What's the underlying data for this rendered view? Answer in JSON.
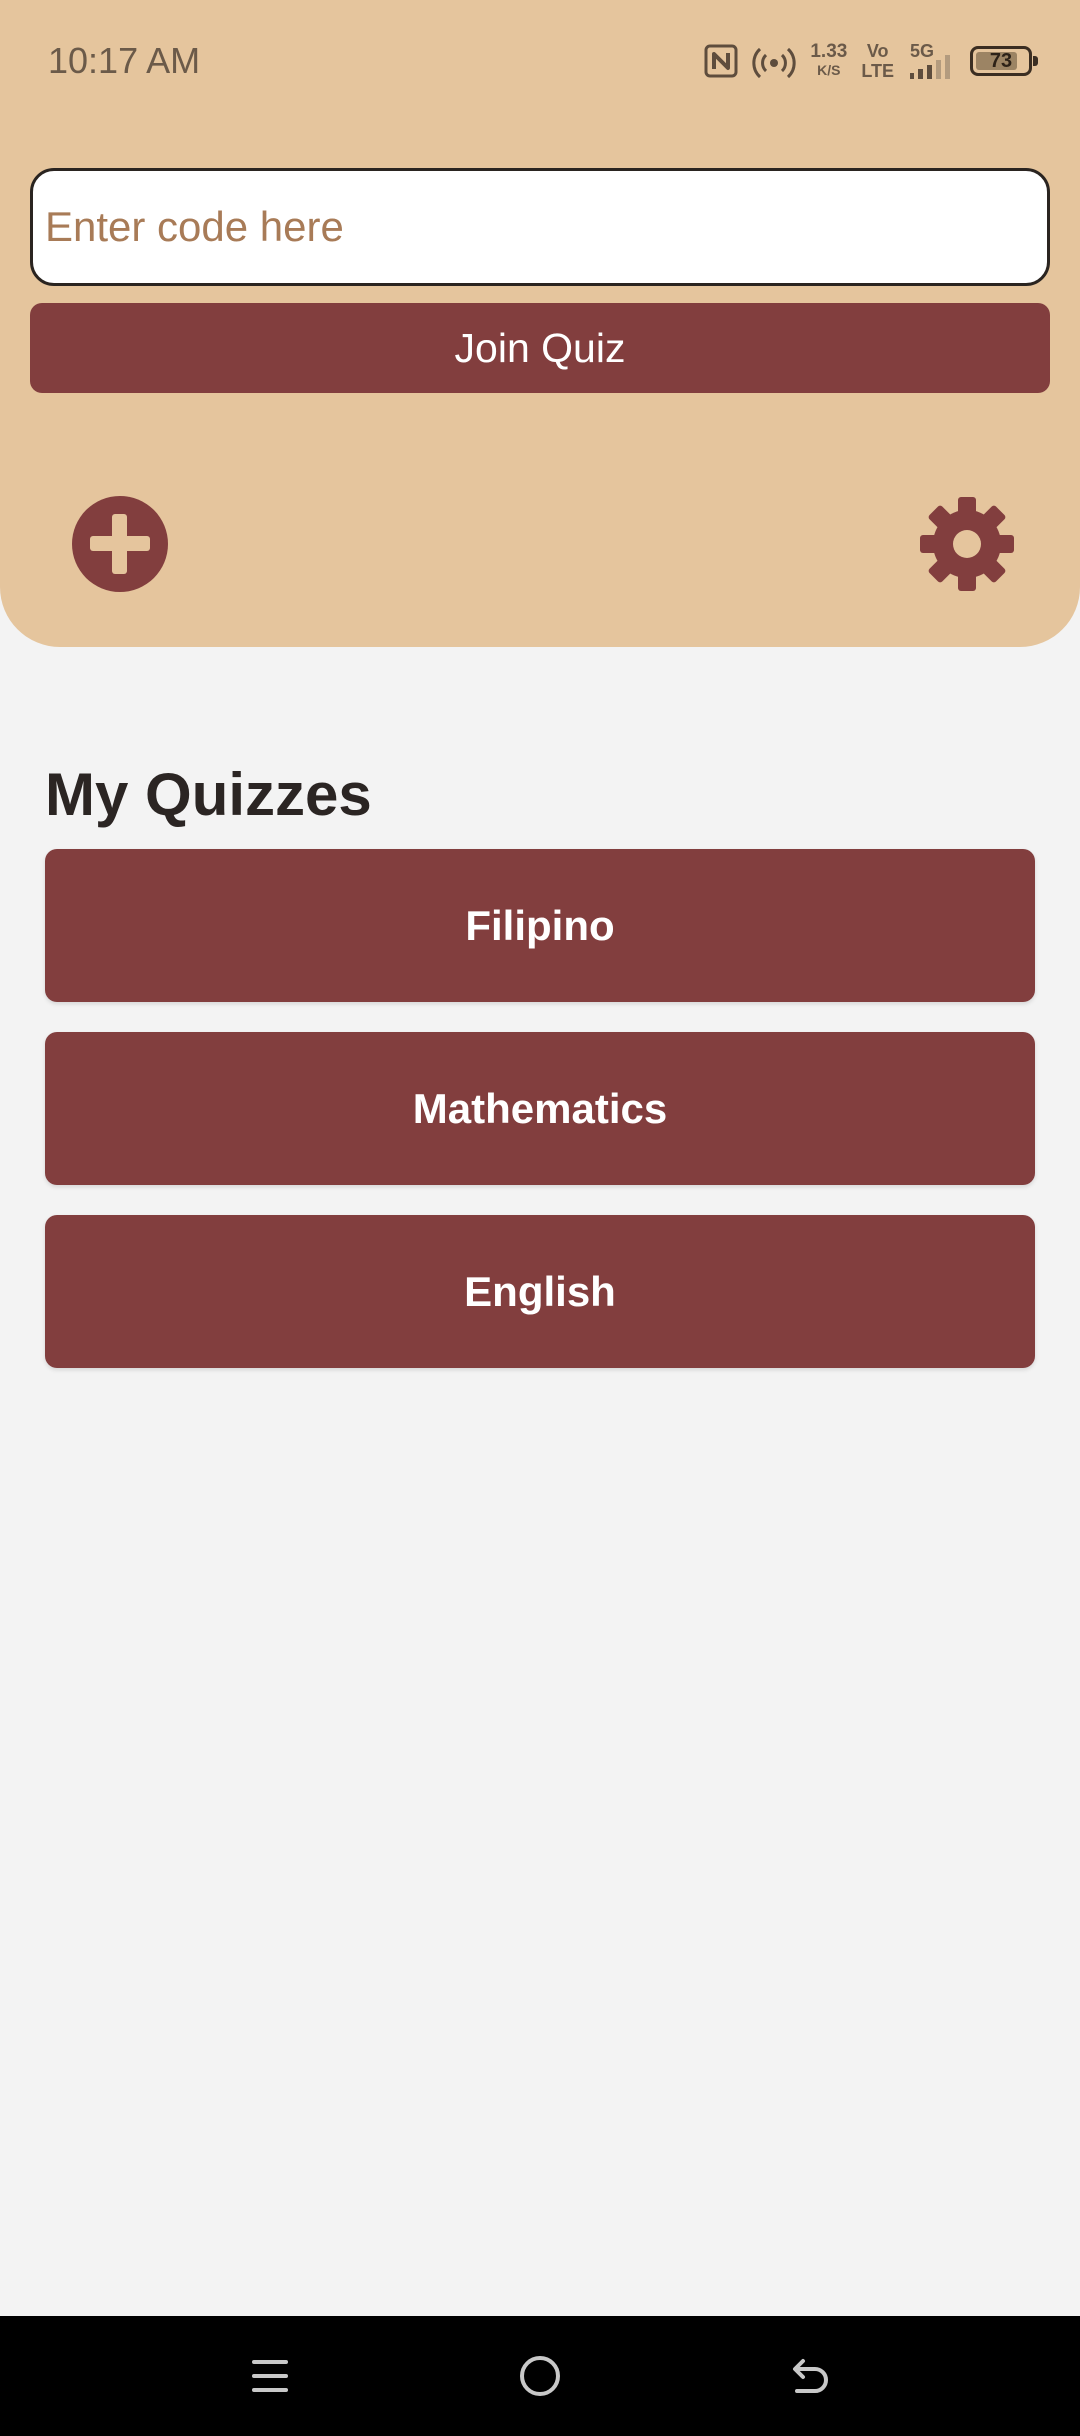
{
  "status_bar": {
    "time": "10:17 AM",
    "speed_value": "1.33",
    "speed_unit": "K/S",
    "volte_top": "Vo",
    "volte_bottom": "LTE",
    "network": "5G",
    "battery_level": "73",
    "icons": [
      "nfc-icon",
      "hotspot-icon",
      "signal-icon",
      "battery-icon"
    ]
  },
  "join": {
    "placeholder": "Enter code here",
    "value": "",
    "button_label": "Join Quiz"
  },
  "actions": {
    "add_icon": "plus-circle-icon",
    "settings_icon": "gear-icon"
  },
  "quizzes": {
    "title": "My Quizzes",
    "items": [
      {
        "label": "Filipino"
      },
      {
        "label": "Mathematics"
      },
      {
        "label": "English"
      }
    ]
  },
  "navigation": {
    "icons": [
      "menu-icon",
      "home-icon",
      "back-icon"
    ]
  },
  "colors": {
    "panel": "#e5c59d",
    "accent": "#823e3e",
    "background": "#f3f3f3",
    "placeholder": "#a87b57"
  }
}
